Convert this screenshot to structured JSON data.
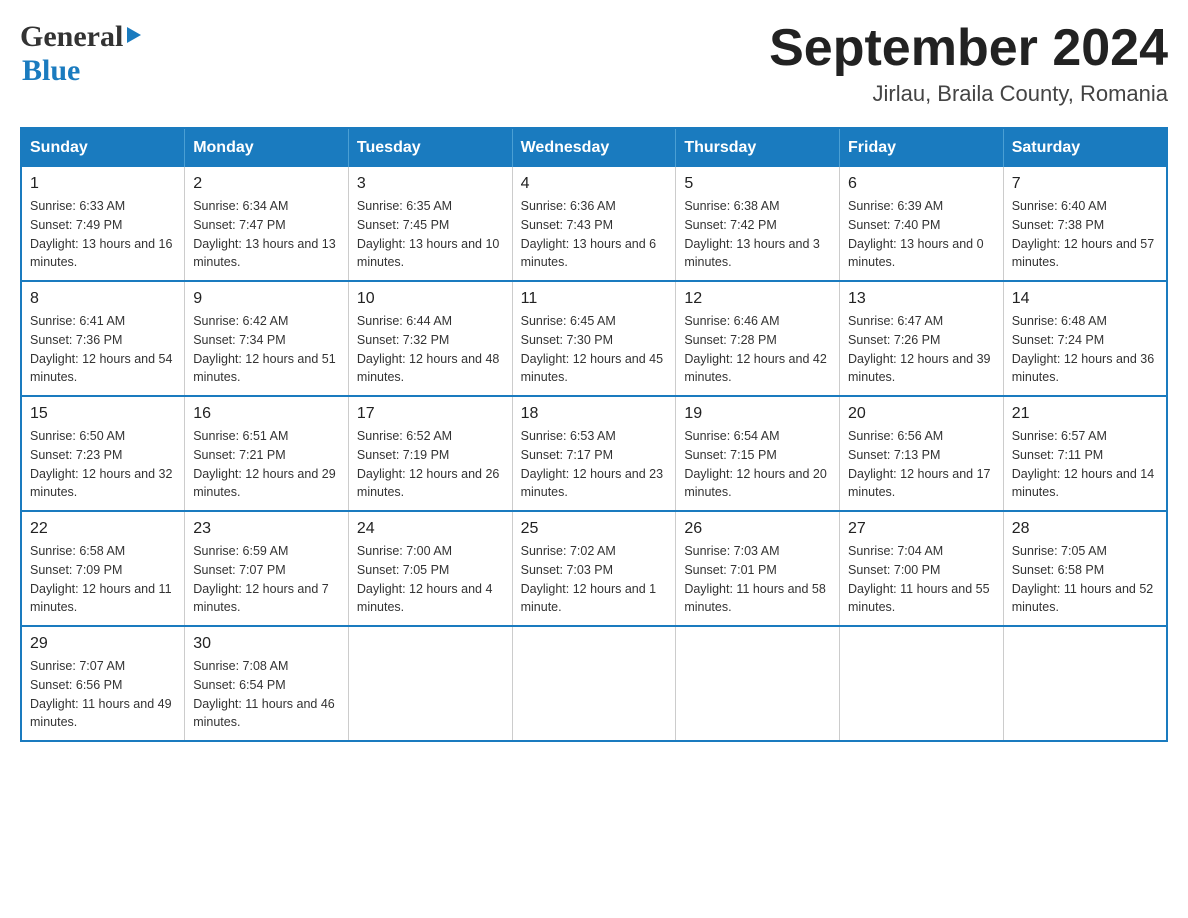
{
  "header": {
    "logo_line1": "General",
    "logo_line2": "Blue",
    "title": "September 2024",
    "subtitle": "Jirlau, Braila County, Romania"
  },
  "calendar": {
    "days_of_week": [
      "Sunday",
      "Monday",
      "Tuesday",
      "Wednesday",
      "Thursday",
      "Friday",
      "Saturday"
    ],
    "weeks": [
      [
        {
          "day": "1",
          "sunrise": "Sunrise: 6:33 AM",
          "sunset": "Sunset: 7:49 PM",
          "daylight": "Daylight: 13 hours and 16 minutes."
        },
        {
          "day": "2",
          "sunrise": "Sunrise: 6:34 AM",
          "sunset": "Sunset: 7:47 PM",
          "daylight": "Daylight: 13 hours and 13 minutes."
        },
        {
          "day": "3",
          "sunrise": "Sunrise: 6:35 AM",
          "sunset": "Sunset: 7:45 PM",
          "daylight": "Daylight: 13 hours and 10 minutes."
        },
        {
          "day": "4",
          "sunrise": "Sunrise: 6:36 AM",
          "sunset": "Sunset: 7:43 PM",
          "daylight": "Daylight: 13 hours and 6 minutes."
        },
        {
          "day": "5",
          "sunrise": "Sunrise: 6:38 AM",
          "sunset": "Sunset: 7:42 PM",
          "daylight": "Daylight: 13 hours and 3 minutes."
        },
        {
          "day": "6",
          "sunrise": "Sunrise: 6:39 AM",
          "sunset": "Sunset: 7:40 PM",
          "daylight": "Daylight: 13 hours and 0 minutes."
        },
        {
          "day": "7",
          "sunrise": "Sunrise: 6:40 AM",
          "sunset": "Sunset: 7:38 PM",
          "daylight": "Daylight: 12 hours and 57 minutes."
        }
      ],
      [
        {
          "day": "8",
          "sunrise": "Sunrise: 6:41 AM",
          "sunset": "Sunset: 7:36 PM",
          "daylight": "Daylight: 12 hours and 54 minutes."
        },
        {
          "day": "9",
          "sunrise": "Sunrise: 6:42 AM",
          "sunset": "Sunset: 7:34 PM",
          "daylight": "Daylight: 12 hours and 51 minutes."
        },
        {
          "day": "10",
          "sunrise": "Sunrise: 6:44 AM",
          "sunset": "Sunset: 7:32 PM",
          "daylight": "Daylight: 12 hours and 48 minutes."
        },
        {
          "day": "11",
          "sunrise": "Sunrise: 6:45 AM",
          "sunset": "Sunset: 7:30 PM",
          "daylight": "Daylight: 12 hours and 45 minutes."
        },
        {
          "day": "12",
          "sunrise": "Sunrise: 6:46 AM",
          "sunset": "Sunset: 7:28 PM",
          "daylight": "Daylight: 12 hours and 42 minutes."
        },
        {
          "day": "13",
          "sunrise": "Sunrise: 6:47 AM",
          "sunset": "Sunset: 7:26 PM",
          "daylight": "Daylight: 12 hours and 39 minutes."
        },
        {
          "day": "14",
          "sunrise": "Sunrise: 6:48 AM",
          "sunset": "Sunset: 7:24 PM",
          "daylight": "Daylight: 12 hours and 36 minutes."
        }
      ],
      [
        {
          "day": "15",
          "sunrise": "Sunrise: 6:50 AM",
          "sunset": "Sunset: 7:23 PM",
          "daylight": "Daylight: 12 hours and 32 minutes."
        },
        {
          "day": "16",
          "sunrise": "Sunrise: 6:51 AM",
          "sunset": "Sunset: 7:21 PM",
          "daylight": "Daylight: 12 hours and 29 minutes."
        },
        {
          "day": "17",
          "sunrise": "Sunrise: 6:52 AM",
          "sunset": "Sunset: 7:19 PM",
          "daylight": "Daylight: 12 hours and 26 minutes."
        },
        {
          "day": "18",
          "sunrise": "Sunrise: 6:53 AM",
          "sunset": "Sunset: 7:17 PM",
          "daylight": "Daylight: 12 hours and 23 minutes."
        },
        {
          "day": "19",
          "sunrise": "Sunrise: 6:54 AM",
          "sunset": "Sunset: 7:15 PM",
          "daylight": "Daylight: 12 hours and 20 minutes."
        },
        {
          "day": "20",
          "sunrise": "Sunrise: 6:56 AM",
          "sunset": "Sunset: 7:13 PM",
          "daylight": "Daylight: 12 hours and 17 minutes."
        },
        {
          "day": "21",
          "sunrise": "Sunrise: 6:57 AM",
          "sunset": "Sunset: 7:11 PM",
          "daylight": "Daylight: 12 hours and 14 minutes."
        }
      ],
      [
        {
          "day": "22",
          "sunrise": "Sunrise: 6:58 AM",
          "sunset": "Sunset: 7:09 PM",
          "daylight": "Daylight: 12 hours and 11 minutes."
        },
        {
          "day": "23",
          "sunrise": "Sunrise: 6:59 AM",
          "sunset": "Sunset: 7:07 PM",
          "daylight": "Daylight: 12 hours and 7 minutes."
        },
        {
          "day": "24",
          "sunrise": "Sunrise: 7:00 AM",
          "sunset": "Sunset: 7:05 PM",
          "daylight": "Daylight: 12 hours and 4 minutes."
        },
        {
          "day": "25",
          "sunrise": "Sunrise: 7:02 AM",
          "sunset": "Sunset: 7:03 PM",
          "daylight": "Daylight: 12 hours and 1 minute."
        },
        {
          "day": "26",
          "sunrise": "Sunrise: 7:03 AM",
          "sunset": "Sunset: 7:01 PM",
          "daylight": "Daylight: 11 hours and 58 minutes."
        },
        {
          "day": "27",
          "sunrise": "Sunrise: 7:04 AM",
          "sunset": "Sunset: 7:00 PM",
          "daylight": "Daylight: 11 hours and 55 minutes."
        },
        {
          "day": "28",
          "sunrise": "Sunrise: 7:05 AM",
          "sunset": "Sunset: 6:58 PM",
          "daylight": "Daylight: 11 hours and 52 minutes."
        }
      ],
      [
        {
          "day": "29",
          "sunrise": "Sunrise: 7:07 AM",
          "sunset": "Sunset: 6:56 PM",
          "daylight": "Daylight: 11 hours and 49 minutes."
        },
        {
          "day": "30",
          "sunrise": "Sunrise: 7:08 AM",
          "sunset": "Sunset: 6:54 PM",
          "daylight": "Daylight: 11 hours and 46 minutes."
        },
        null,
        null,
        null,
        null,
        null
      ]
    ]
  }
}
